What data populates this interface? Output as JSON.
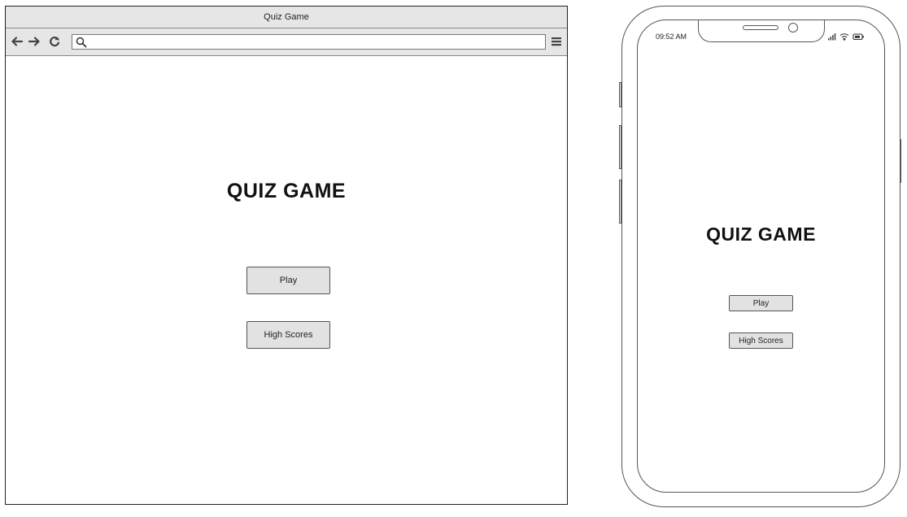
{
  "browser": {
    "window_title": "Quiz Game",
    "toolbar": {
      "back_icon": "arrow-left-icon",
      "forward_icon": "arrow-right-icon",
      "reload_icon": "reload-icon",
      "search_icon": "search-icon",
      "url_value": "",
      "menu_icon": "hamburger-menu-icon"
    },
    "content": {
      "title": "QUIZ GAME",
      "play_label": "Play",
      "high_scores_label": "High Scores"
    }
  },
  "phone": {
    "status_bar": {
      "time": "09:52 AM",
      "icons": [
        "signal-icon",
        "wifi-icon",
        "battery-icon"
      ]
    },
    "content": {
      "title": "QUIZ GAME",
      "play_label": "Play",
      "high_scores_label": "High Scores"
    }
  },
  "colors": {
    "chrome_bar": "#e6e6e6",
    "button_fill": "#e2e2e2",
    "outline": "#555555"
  }
}
